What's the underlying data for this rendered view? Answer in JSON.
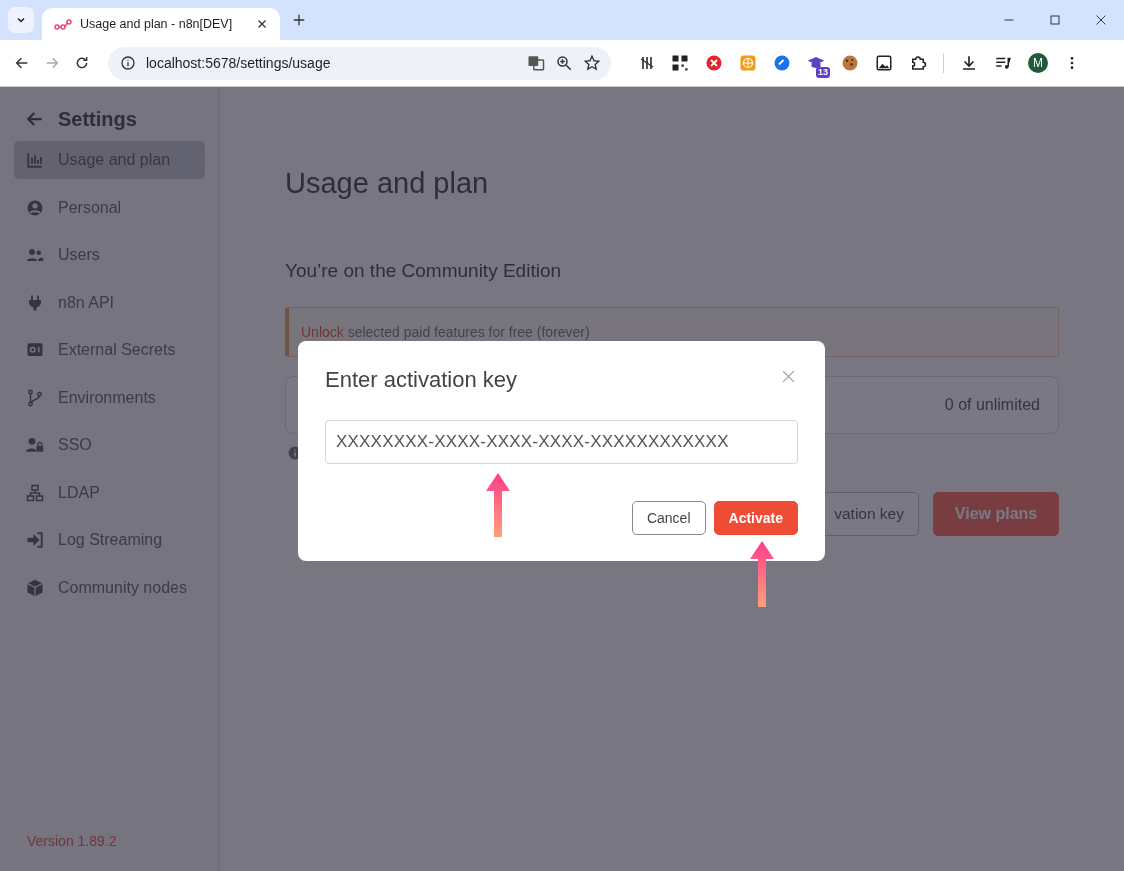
{
  "browser": {
    "tab_title": "Usage and plan - n8n[DEV]",
    "url": "localhost:5678/settings/usage",
    "extension_badge": "13",
    "profile_initial": "M"
  },
  "sidebar": {
    "title": "Settings",
    "items": [
      {
        "label": "Usage and plan",
        "selected": true
      },
      {
        "label": "Personal",
        "selected": false
      },
      {
        "label": "Users",
        "selected": false
      },
      {
        "label": "n8n API",
        "selected": false
      },
      {
        "label": "External Secrets",
        "selected": false
      },
      {
        "label": "Environments",
        "selected": false
      },
      {
        "label": "SSO",
        "selected": false
      },
      {
        "label": "LDAP",
        "selected": false
      },
      {
        "label": "Log Streaming",
        "selected": false
      },
      {
        "label": "Community nodes",
        "selected": false
      }
    ],
    "version": "Version 1.89.2"
  },
  "main": {
    "title": "Usage and plan",
    "subtitle": "You’re on the Community Edition",
    "banner": {
      "link": "Unlock",
      "text": "selected paid features for free (forever)"
    },
    "usage_value": "0 of unlimited",
    "buttons": [
      {
        "label": "vation key",
        "kind": "secondary"
      },
      {
        "label": "View plans",
        "kind": "primary"
      }
    ]
  },
  "dialog": {
    "title": "Enter activation key",
    "input_value": "XXXXXXXX-XXXX-XXXX-XXXX-XXXXXXXXXXXX",
    "buttons": [
      {
        "label": "Cancel",
        "kind": "secondary"
      },
      {
        "label": "Activate",
        "kind": "primary"
      }
    ]
  }
}
